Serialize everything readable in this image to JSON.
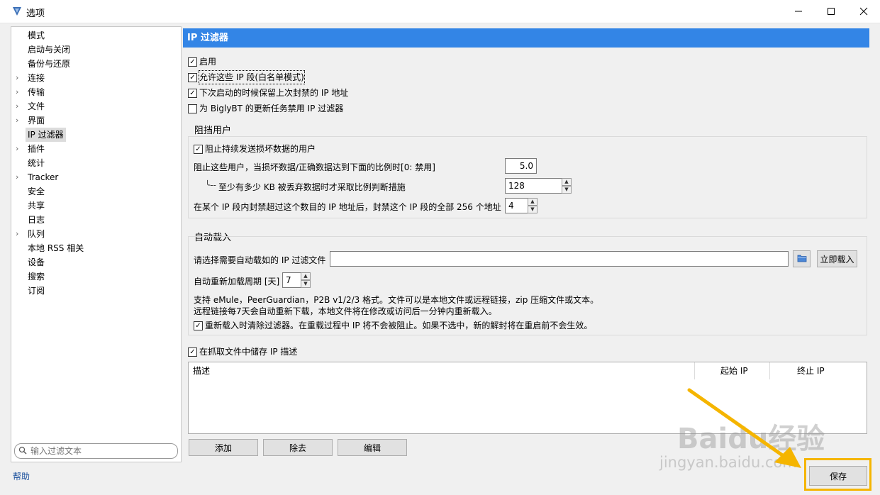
{
  "window": {
    "title": "选项"
  },
  "sidebar": {
    "items": [
      {
        "label": "模式",
        "expandable": false,
        "selected": false
      },
      {
        "label": "启动与关闭",
        "expandable": false,
        "selected": false
      },
      {
        "label": "备份与还原",
        "expandable": false,
        "selected": false
      },
      {
        "label": "连接",
        "expandable": true,
        "selected": false
      },
      {
        "label": "传输",
        "expandable": true,
        "selected": false
      },
      {
        "label": "文件",
        "expandable": true,
        "selected": false
      },
      {
        "label": "界面",
        "expandable": true,
        "selected": false
      },
      {
        "label": "IP 过滤器",
        "expandable": false,
        "selected": true
      },
      {
        "label": "插件",
        "expandable": true,
        "selected": false
      },
      {
        "label": "统计",
        "expandable": false,
        "selected": false
      },
      {
        "label": "Tracker",
        "expandable": true,
        "selected": false
      },
      {
        "label": "安全",
        "expandable": false,
        "selected": false
      },
      {
        "label": "共享",
        "expandable": false,
        "selected": false
      },
      {
        "label": "日志",
        "expandable": false,
        "selected": false
      },
      {
        "label": "队列",
        "expandable": true,
        "selected": false
      },
      {
        "label": "本地 RSS 相关",
        "expandable": false,
        "selected": false
      },
      {
        "label": "设备",
        "expandable": false,
        "selected": false
      },
      {
        "label": "搜索",
        "expandable": false,
        "selected": false
      },
      {
        "label": "订阅",
        "expandable": false,
        "selected": false
      }
    ],
    "filter_placeholder": "输入过滤文本",
    "help": "帮助"
  },
  "panel": {
    "title": "IP 过滤器",
    "enable": {
      "label": "启用",
      "checked": true
    },
    "whitelist": {
      "label": "允许这些 IP 段(白名单模式)",
      "checked": true
    },
    "keep_banned": {
      "label": "下次启动的时候保留上次封禁的 IP 地址",
      "checked": true
    },
    "disable_updates": {
      "label": "为 BiglyBT 的更新任务禁用 IP 过滤器",
      "checked": false
    }
  },
  "block": {
    "title": "阻挡用户",
    "block_bad": {
      "label": "阻止持续发送损坏数据的用户",
      "checked": true
    },
    "ratio_label": "阻止这些用户，当损坏数据/正确数据达到下面的比例时[0: 禁用]",
    "ratio_value": "5.0",
    "kb_label": "至少有多少 KB 被丢弃数据时才采取比例判断措施",
    "kb_value": "128",
    "ban_label": "在某个 IP 段内封禁超过这个数目的 IP 地址后，封禁这个 IP 段的全部 256 个地址",
    "ban_value": "4"
  },
  "autoload": {
    "title": "自动载入",
    "file_label": "请选择需要自动载如的 IP 过滤文件",
    "file_value": "",
    "load_now": "立即载入",
    "period_label": "自动重新加载周期 [天]",
    "period_value": "7",
    "info1": "支持 eMule，PeerGuardian，P2B v1/2/3 格式。文件可以是本地文件或远程链接，zip 压缩文件或文本。",
    "info2": "远程链接每7天会自动重新下载，本地文件将在修改或访问后一分钟内重新载入。",
    "clear": {
      "label": "重新载入时清除过滤器。在重载过程中 IP 将不会被阻止。如果不选中，新的解封将在重启前不会生效。",
      "checked": true
    }
  },
  "store_desc": {
    "label": "在抓取文件中储存 IP 描述",
    "checked": true
  },
  "table": {
    "columns": [
      "描述",
      "起始 IP",
      "终止 IP"
    ]
  },
  "buttons": {
    "add": "添加",
    "remove": "除去",
    "edit": "编辑",
    "save": "保存"
  },
  "watermark": {
    "brand": "Baidu经验",
    "url": "jingyan.baidu.com"
  },
  "colors": {
    "header": "#3385e6",
    "highlight": "#f5b500"
  }
}
